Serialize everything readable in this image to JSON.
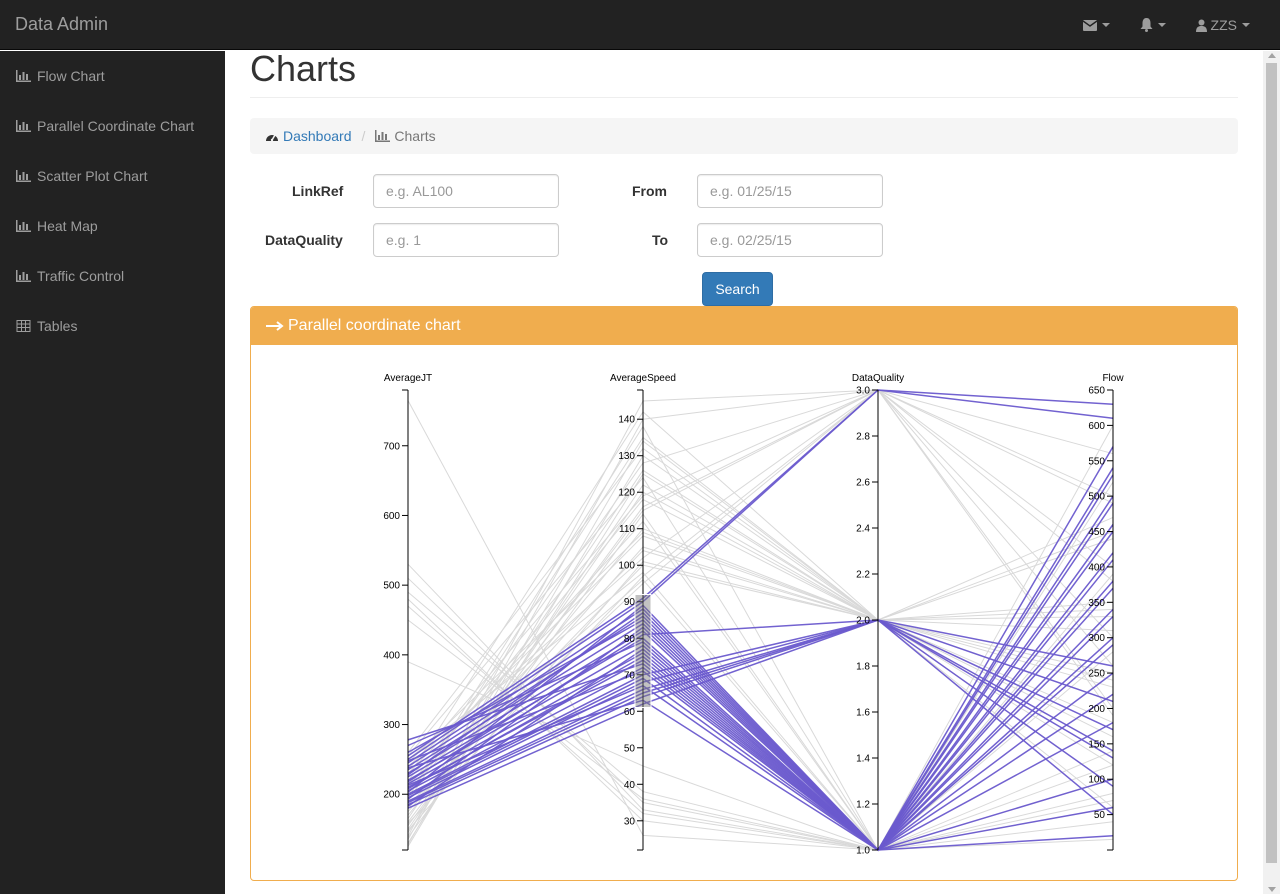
{
  "app": {
    "brand": "Data Admin",
    "user": "ZZS"
  },
  "sidebar": {
    "items": [
      {
        "label": "Flow Chart",
        "icon": "bar-chart-icon"
      },
      {
        "label": "Parallel Coordinate Chart",
        "icon": "bar-chart-icon"
      },
      {
        "label": "Scatter Plot Chart",
        "icon": "bar-chart-icon"
      },
      {
        "label": "Heat Map",
        "icon": "bar-chart-icon"
      },
      {
        "label": "Traffic Control",
        "icon": "bar-chart-icon"
      },
      {
        "label": "Tables",
        "icon": "table-icon"
      }
    ]
  },
  "page": {
    "title": "Charts"
  },
  "breadcrumb": {
    "home": "Dashboard",
    "sep": "/",
    "current": "Charts"
  },
  "form": {
    "linkref_label": "LinkRef",
    "linkref_placeholder": "e.g. AL100",
    "from_label": "From",
    "from_placeholder": "e.g. 01/25/15",
    "dataquality_label": "DataQuality",
    "dataquality_placeholder": "e.g. 1",
    "to_label": "To",
    "to_placeholder": "e.g. 02/25/15",
    "search_label": "Search"
  },
  "panel": {
    "title": "Parallel coordinate chart"
  },
  "colors": {
    "accent": "#f0ad4e",
    "primary": "#337ab7",
    "selected_line": "#6a5acd",
    "context_line": "#d9d9d9"
  },
  "chart_data": {
    "type": "parallel-coordinates",
    "axes": [
      {
        "name": "AverageJT",
        "domain": [
          120,
          780
        ],
        "ticks": [
          200,
          300,
          400,
          500,
          600,
          700
        ]
      },
      {
        "name": "AverageSpeed",
        "domain": [
          22,
          148
        ],
        "ticks": [
          30,
          40,
          50,
          60,
          70,
          80,
          90,
          100,
          110,
          120,
          130,
          140
        ],
        "brush": [
          61,
          92
        ]
      },
      {
        "name": "DataQuality",
        "domain": [
          1.0,
          3.0
        ],
        "ticks": [
          "1.0",
          "1.2",
          "1.4",
          "1.6",
          "1.8",
          "2.0",
          "2.2",
          "2.4",
          "2.6",
          "2.8",
          "3.0"
        ]
      },
      {
        "name": "Flow",
        "domain": [
          0,
          650
        ],
        "ticks": [
          50,
          100,
          150,
          200,
          250,
          300,
          350,
          400,
          450,
          500,
          550,
          600,
          650
        ]
      }
    ],
    "context_lines": [
      [
        765,
        26,
        1.0,
        15
      ],
      [
        530,
        33,
        1.0,
        60
      ],
      [
        510,
        35,
        1.0,
        80
      ],
      [
        490,
        38,
        1.0,
        120
      ],
      [
        480,
        30,
        1.0,
        40
      ],
      [
        470,
        32,
        1.0,
        70
      ],
      [
        450,
        36,
        1.0,
        100
      ],
      [
        390,
        45,
        1.0,
        140
      ],
      [
        125,
        130,
        2.0,
        60
      ],
      [
        130,
        125,
        2.0,
        120
      ],
      [
        135,
        140,
        3.0,
        200
      ],
      [
        140,
        145,
        3.0,
        300
      ],
      [
        150,
        120,
        2.0,
        250
      ],
      [
        160,
        115,
        3.0,
        400
      ],
      [
        170,
        110,
        2.0,
        350
      ],
      [
        175,
        105,
        2.0,
        180
      ],
      [
        180,
        100,
        2.0,
        90
      ],
      [
        185,
        95,
        3.0,
        500
      ],
      [
        190,
        135,
        2.0,
        450
      ],
      [
        200,
        128,
        3.0,
        380
      ],
      [
        210,
        118,
        2.0,
        330
      ],
      [
        220,
        112,
        1.0,
        280
      ],
      [
        230,
        108,
        2.0,
        230
      ],
      [
        240,
        102,
        3.0,
        560
      ],
      [
        250,
        98,
        1.0,
        600
      ],
      [
        260,
        132,
        2.0,
        160
      ],
      [
        145,
        122,
        2.0,
        210
      ],
      [
        155,
        116,
        3.0,
        260
      ],
      [
        165,
        126,
        2.0,
        310
      ],
      [
        195,
        138,
        1.0,
        420
      ],
      [
        205,
        104,
        2.0,
        470
      ],
      [
        215,
        96,
        1.0,
        520
      ],
      [
        225,
        142,
        2.0,
        140
      ],
      [
        235,
        119,
        3.0,
        190
      ],
      [
        245,
        109,
        2.0,
        240
      ],
      [
        255,
        124,
        1.0,
        290
      ],
      [
        128,
        134,
        2.0,
        340
      ],
      [
        138,
        114,
        1.0,
        390
      ],
      [
        148,
        101,
        2.0,
        440
      ],
      [
        158,
        97,
        3.0,
        490
      ]
    ],
    "selected_lines": [
      [
        180,
        62,
        2.0,
        50
      ],
      [
        185,
        64,
        2.0,
        90
      ],
      [
        190,
        66,
        2.0,
        130
      ],
      [
        195,
        68,
        2.0,
        170
      ],
      [
        200,
        70,
        2.0,
        210
      ],
      [
        205,
        72,
        1.0,
        250
      ],
      [
        210,
        74,
        1.0,
        290
      ],
      [
        215,
        76,
        1.0,
        330
      ],
      [
        220,
        78,
        1.0,
        370
      ],
      [
        225,
        80,
        1.0,
        410
      ],
      [
        230,
        82,
        1.0,
        450
      ],
      [
        235,
        84,
        1.0,
        490
      ],
      [
        240,
        86,
        1.0,
        530
      ],
      [
        245,
        88,
        1.0,
        570
      ],
      [
        250,
        90,
        3.0,
        610
      ],
      [
        255,
        91,
        3.0,
        630
      ],
      [
        260,
        85,
        1.0,
        20
      ],
      [
        270,
        79,
        1.0,
        60
      ],
      [
        278,
        73,
        1.0,
        100
      ],
      [
        188,
        65,
        2.0,
        140
      ],
      [
        198,
        69,
        1.0,
        180
      ],
      [
        208,
        75,
        1.0,
        220
      ],
      [
        218,
        81,
        2.0,
        260
      ],
      [
        228,
        87,
        1.0,
        300
      ],
      [
        238,
        63,
        1.0,
        340
      ],
      [
        248,
        71,
        1.0,
        380
      ],
      [
        183,
        77,
        1.0,
        420
      ],
      [
        193,
        83,
        1.0,
        460
      ],
      [
        203,
        89,
        1.0,
        500
      ],
      [
        213,
        67,
        1.0,
        540
      ]
    ]
  }
}
